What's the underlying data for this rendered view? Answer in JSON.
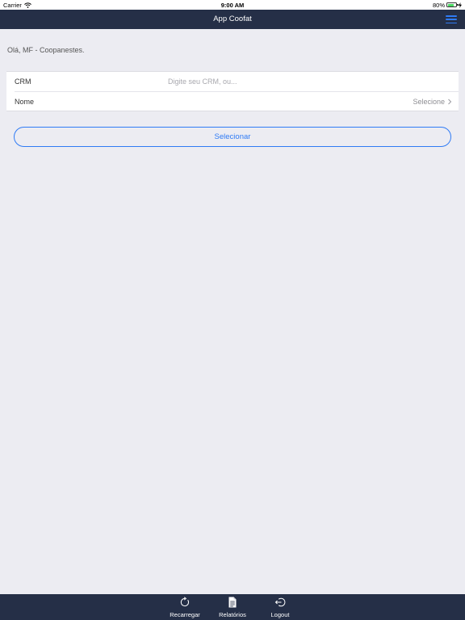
{
  "status_bar": {
    "carrier": "Carrier",
    "time": "9:00 AM",
    "battery_percent": "80%",
    "battery_level": 0.8
  },
  "nav_bar": {
    "title": "App Coofat",
    "menu_icon": "hamburger-menu-icon",
    "accent_color": "#2f7bf5",
    "background_color": "#252f47"
  },
  "greeting": "Olá, MF - Coopanestes.",
  "form": {
    "crm": {
      "label": "CRM",
      "value": "",
      "placeholder": "Digite seu CRM, ou..."
    },
    "nome": {
      "label": "Nome",
      "value": "Selecione",
      "icon": "chevron-right-icon"
    }
  },
  "select_button": {
    "label": "Selecionar"
  },
  "tab_bar": {
    "items": [
      {
        "label": "Recarregar",
        "icon": "reload-icon"
      },
      {
        "label": "Relatórios",
        "icon": "document-icon"
      },
      {
        "label": "Logout",
        "icon": "logout-icon"
      }
    ]
  }
}
